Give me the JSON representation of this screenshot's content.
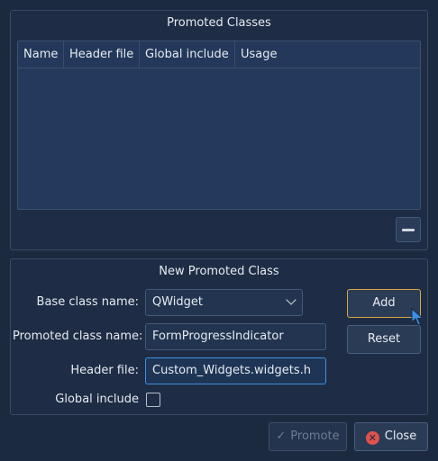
{
  "promoted_classes": {
    "title": "Promoted Classes",
    "columns": [
      "Name",
      "Header file",
      "Global include",
      "Usage"
    ]
  },
  "new_promoted_class": {
    "title": "New Promoted Class",
    "base_class_label": "Base class name:",
    "base_class_value": "QWidget",
    "promoted_class_label": "Promoted class name:",
    "promoted_class_value": "FormProgressIndicator",
    "header_file_label": "Header file:",
    "header_file_value": "Custom_Widgets.widgets.h",
    "global_include_label": "Global include",
    "global_include_checked": false,
    "add_label": "Add",
    "reset_label": "Reset"
  },
  "footer": {
    "promote_label": "Promote",
    "close_label": "Close"
  },
  "icons": {
    "remove": "minus-icon",
    "promote": "check-icon",
    "close": "close-icon",
    "combo": "chevron-down-icon"
  }
}
